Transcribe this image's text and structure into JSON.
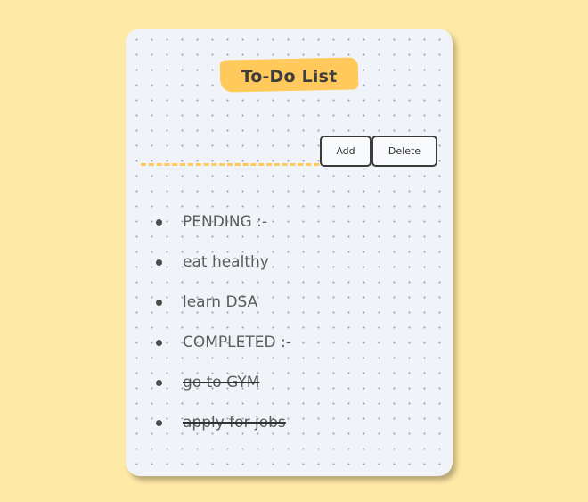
{
  "app": {
    "title": "To-Do List"
  },
  "input": {
    "value": "",
    "placeholder": ""
  },
  "toolbar": {
    "add_label": "Add",
    "delete_label": "Delete"
  },
  "tasks": [
    {
      "text": "PENDING :-",
      "completed": false
    },
    {
      "text": "eat healthy",
      "completed": false
    },
    {
      "text": "learn DSA",
      "completed": false
    },
    {
      "text": "COMPLETED :-",
      "completed": false
    },
    {
      "text": "go to GYM",
      "completed": true
    },
    {
      "text": "apply for jobs",
      "completed": true
    }
  ],
  "colors": {
    "page_background": "#ffe9a6",
    "card_background": "#f0f4f8",
    "accent": "#ffc95c",
    "text": "#5b5b5b"
  }
}
